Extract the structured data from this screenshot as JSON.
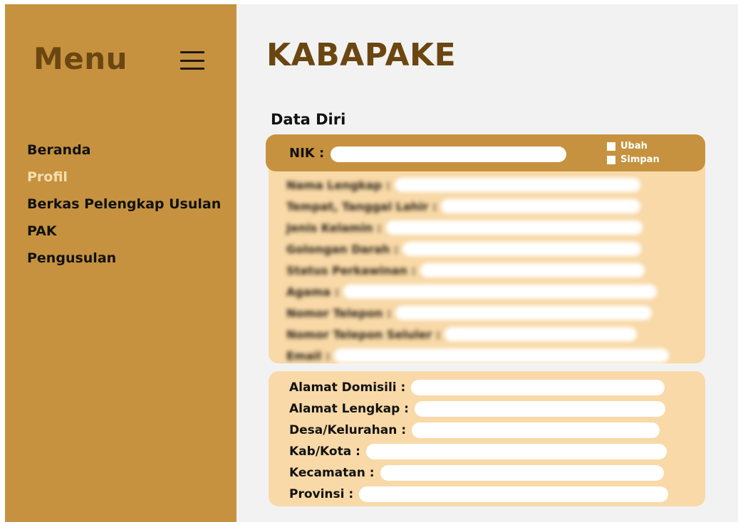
{
  "sidebar": {
    "title": "Menu",
    "menu_icon": "hamburger-icon",
    "items": [
      {
        "label": "Beranda",
        "active": false
      },
      {
        "label": "Profil",
        "active": true
      },
      {
        "label": "Berkas Pelengkap Usulan",
        "active": false
      },
      {
        "label": "PAK",
        "active": false
      },
      {
        "label": "Pengusulan",
        "active": false
      }
    ]
  },
  "main": {
    "app_title": "KABAPAKE",
    "section_title": "Data Diri",
    "nik": {
      "label": "NIK :",
      "value": ""
    },
    "actions": {
      "edit_label": "Ubah",
      "save_label": "Simpan"
    },
    "personal_fields": [
      {
        "label": "Nama Lengkap :",
        "value": ""
      },
      {
        "label": "Tempat, Tanggal Lahir :",
        "value": ""
      },
      {
        "label": "Jenis Kelamin :",
        "value": ""
      },
      {
        "label": "Golongan Darah :",
        "value": ""
      },
      {
        "label": "Status Perkawinan :",
        "value": ""
      },
      {
        "label": "Agama :",
        "value": ""
      },
      {
        "label": "Nomor Telepon :",
        "value": ""
      },
      {
        "label": "Nomor Telepon Seluler :",
        "value": ""
      },
      {
        "label": "Email :",
        "value": ""
      }
    ],
    "address_fields": [
      {
        "label": "Alamat Domisili :",
        "value": ""
      },
      {
        "label": "Alamat Lengkap :",
        "value": ""
      },
      {
        "label": "Desa/Kelurahan :",
        "value": ""
      },
      {
        "label": "Kab/Kota :",
        "value": ""
      },
      {
        "label": "Kecamatan :",
        "value": ""
      },
      {
        "label": "Provinsi :",
        "value": ""
      }
    ]
  },
  "colors": {
    "sidebar_bg": "#c6923f",
    "title_brown": "#6b4611",
    "panel_bg": "#f8d9a7",
    "active_nav": "#f6deb0",
    "content_bg": "#f2f2f2"
  }
}
